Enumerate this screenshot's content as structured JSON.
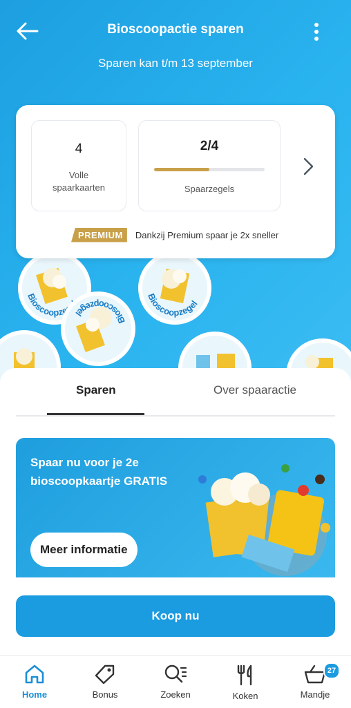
{
  "header": {
    "title": "Bioscoopactie sparen",
    "subtitle": "Sparen kan t/m 13 september"
  },
  "summary": {
    "full_cards_count": "4",
    "full_cards_label_line1": "Volle",
    "full_cards_label_line2": "spaarkaarten",
    "stamps_count": "2/4",
    "stamps_progress": 0.5,
    "stamps_label": "Spaarzegels",
    "premium_badge": "PREMIUM",
    "premium_text": "Dankzij Premium spaar je 2x sneller"
  },
  "stamps": {
    "label": "Bioscoopzegel"
  },
  "tabs": [
    {
      "label": "Sparen",
      "active": true
    },
    {
      "label": "Over spaaractie",
      "active": false
    }
  ],
  "promo": {
    "line1": "Spaar nu voor je 2e",
    "line2": "bioscoopkaartje GRATIS",
    "button_label": "Meer informatie"
  },
  "buy_button_label": "Koop nu",
  "bottom_nav": [
    {
      "label": "Home",
      "icon": "home-icon",
      "active": true
    },
    {
      "label": "Bonus",
      "icon": "tag-icon",
      "active": false
    },
    {
      "label": "Zoeken",
      "icon": "search-icon",
      "active": false
    },
    {
      "label": "Koken",
      "icon": "cutlery-icon",
      "active": false
    },
    {
      "label": "Mandje",
      "icon": "basket-icon",
      "active": false,
      "badge": "27"
    }
  ],
  "colors": {
    "brand_blue": "#1b9be0",
    "premium_gold": "#c9a04a"
  }
}
